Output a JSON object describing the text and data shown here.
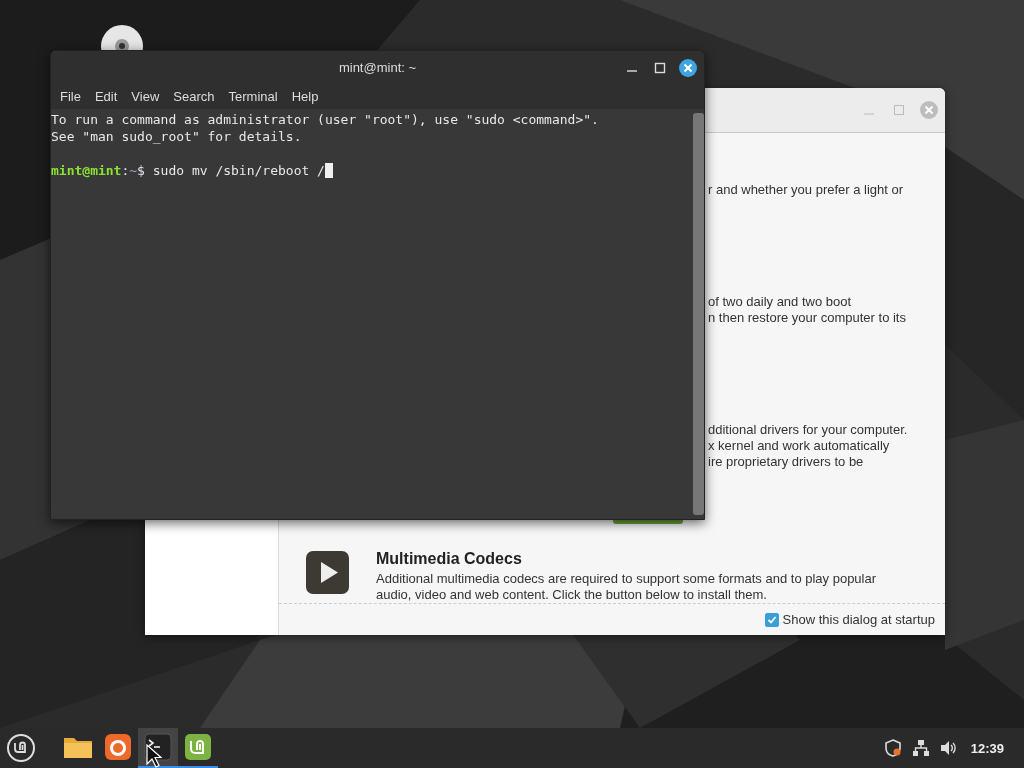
{
  "terminal": {
    "title": "mint@mint: ~",
    "menu": [
      "File",
      "Edit",
      "View",
      "Search",
      "Terminal",
      "Help"
    ],
    "lines": [
      "To run a command as administrator (user \"root\"), use \"sudo <command>\".",
      "See \"man sudo_root\" for details."
    ],
    "prompt": {
      "user": "mint@mint",
      "separator": ":",
      "path": "~",
      "command": "$ sudo mv /sbin/reboot /"
    }
  },
  "welcome": {
    "fragments": [
      [
        "r and whether you prefer a light or"
      ],
      [
        "of two daily and two boot",
        "n then restore your computer to its"
      ],
      [
        "dditional drivers for your computer.",
        "x kernel and work automatically",
        "ire proprietary drivers to be"
      ]
    ],
    "section": {
      "title": "Multimedia Codecs",
      "description": "Additional multimedia codecs are required to support some formats and to play popular audio, video and web content. Click the button below to install them."
    },
    "startup_checkbox": {
      "label": "Show this dialog at startup",
      "checked": true
    }
  },
  "taskbar": {
    "apps": [
      {
        "kind": "files",
        "running": false,
        "selected": false
      },
      {
        "kind": "browser",
        "running": false,
        "selected": false
      },
      {
        "kind": "terminal",
        "running": true,
        "selected": true
      },
      {
        "kind": "welcome",
        "running": true,
        "selected": false
      }
    ],
    "clock": "12:39"
  }
}
